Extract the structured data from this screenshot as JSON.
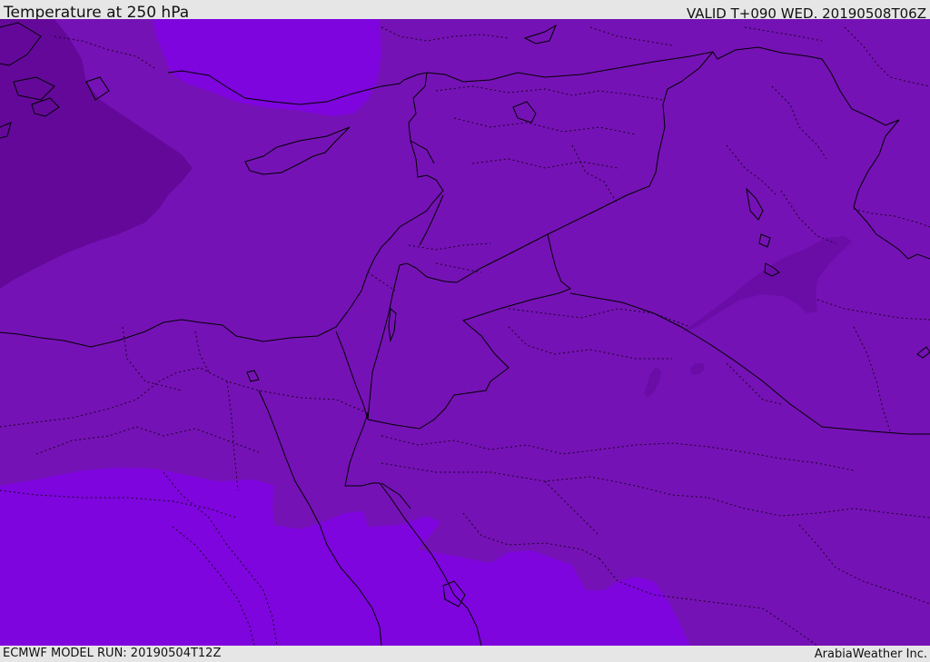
{
  "header": {
    "title": "Temperature at 250 hPa",
    "valid_time": "VALID T+090 WED. 20190508T06Z"
  },
  "footer": {
    "model_run": "ECMWF MODEL RUN: 20190504T12Z",
    "credit": "ArabiaWeather Inc."
  },
  "colors": {
    "field_base": "#7512b5",
    "field_warm": "#7e05dd",
    "field_cold": "#64089a",
    "field_cold_patch": "#6a0ca6",
    "border_line": "#000000",
    "bar_background": "#e6e6e6"
  }
}
